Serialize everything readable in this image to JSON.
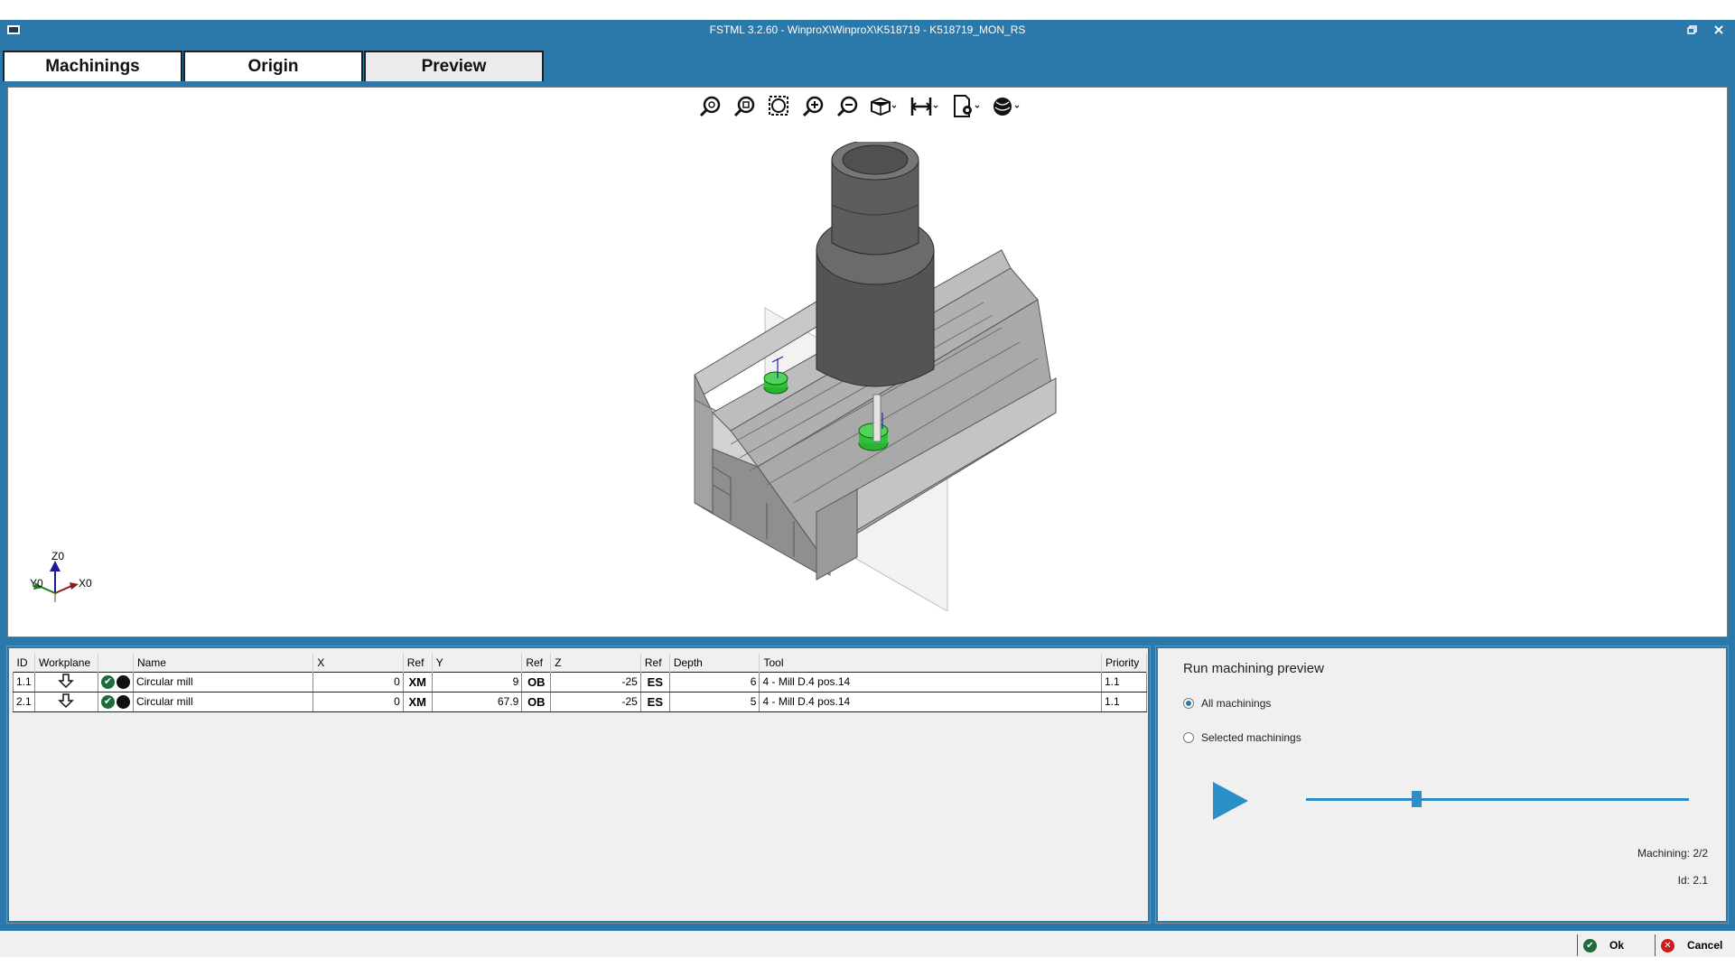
{
  "window": {
    "title": "FSTML 3.2.60 - WinproX\\WinproX\\K518719 - K518719_MON_RS",
    "restore_icon": "restore-icon",
    "close_icon": "close-icon"
  },
  "tabs": [
    {
      "label": "Machinings",
      "active": false
    },
    {
      "label": "Origin",
      "active": false
    },
    {
      "label": "Preview",
      "active": true
    }
  ],
  "viewer": {
    "toolbar": [
      "zoom-all-icon",
      "zoom-selection-icon",
      "zoom-window-icon",
      "zoom-in-icon",
      "zoom-out-icon",
      "view-mode-icon",
      "measure-icon",
      "display-settings-icon",
      "render-style-icon"
    ],
    "axes": {
      "z": "Z0",
      "x": "X0",
      "y": "Y0"
    }
  },
  "table": {
    "columns": [
      "ID",
      "Workplane",
      "",
      "Name",
      "X",
      "Ref",
      "Y",
      "Ref",
      "Z",
      "Ref",
      "Depth",
      "Tool",
      "Priority"
    ],
    "rows": [
      {
        "id": "1.1",
        "name": "Circular mill",
        "x": "0",
        "xref": "XM",
        "y": "9",
        "yref": "OB",
        "z": "-25",
        "zref": "ES",
        "depth": "6",
        "tool": "4 - Mill D.4 pos.14",
        "priority": "1.1"
      },
      {
        "id": "2.1",
        "name": "Circular mill",
        "x": "0",
        "xref": "XM",
        "y": "67.9",
        "yref": "OB",
        "z": "-25",
        "zref": "ES",
        "depth": "5",
        "tool": "4 - Mill D.4 pos.14",
        "priority": "1.1"
      }
    ]
  },
  "preview": {
    "title": "Run machining preview",
    "option_all": "All machinings",
    "option_selected": "Selected machinings",
    "selected_option": "all",
    "progress": 0.29,
    "machining_label": "Machining: 2/2",
    "id_label": "Id: 2.1"
  },
  "actions": {
    "ok": "Ok",
    "cancel": "Cancel"
  },
  "colors": {
    "accent": "#2b79aa",
    "ok": "#1e6b3b",
    "cancel": "#d11a1a",
    "slider": "#2b8fc7"
  }
}
